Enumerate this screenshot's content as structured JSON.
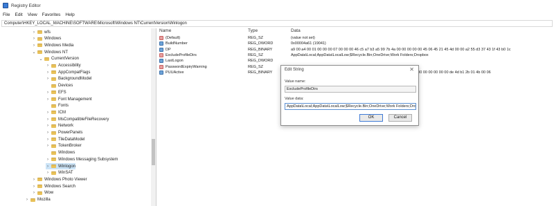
{
  "window": {
    "title": "Registry Editor"
  },
  "menu": [
    "File",
    "Edit",
    "View",
    "Favorites",
    "Help"
  ],
  "address": "Computer\\HKEY_LOCAL_MACHINE\\SOFTWARE\\Microsoft\\Windows NT\\CurrentVersion\\Winlogon",
  "tree": [
    {
      "label": "wfs",
      "chev": "›",
      "indent": 1
    },
    {
      "label": "Windows",
      "chev": "›",
      "indent": 1
    },
    {
      "label": "Windows Media",
      "chev": "›",
      "indent": 1
    },
    {
      "label": "Windows NT",
      "chev": "⌄",
      "indent": 1
    },
    {
      "label": "CurrentVersion",
      "chev": "⌄",
      "indent": 2
    },
    {
      "label": "Accessibility",
      "chev": "›",
      "indent": 3
    },
    {
      "label": "AppCompatFlags",
      "chev": "›",
      "indent": 3
    },
    {
      "label": "BackgroundModel",
      "chev": "›",
      "indent": 3
    },
    {
      "label": "Devices",
      "chev": "",
      "indent": 3
    },
    {
      "label": "EFS",
      "chev": "›",
      "indent": 3
    },
    {
      "label": "Font Management",
      "chev": "›",
      "indent": 3
    },
    {
      "label": "Fonts",
      "chev": "",
      "indent": 3
    },
    {
      "label": "ICM",
      "chev": "›",
      "indent": 3
    },
    {
      "label": "MsCompatibleFileRecovery",
      "chev": "›",
      "indent": 3
    },
    {
      "label": "Network",
      "chev": "›",
      "indent": 3
    },
    {
      "label": "PowerPanels",
      "chev": "›",
      "indent": 3
    },
    {
      "label": "TileDataModel",
      "chev": "›",
      "indent": 3
    },
    {
      "label": "TokenBroker",
      "chev": "›",
      "indent": 3
    },
    {
      "label": "Windows",
      "chev": "",
      "indent": 3
    },
    {
      "label": "Windows Messaging Subsystem",
      "chev": "›",
      "indent": 3
    },
    {
      "label": "Winlogon",
      "chev": "›",
      "indent": 3,
      "selected": true
    },
    {
      "label": "WinSAT",
      "chev": "›",
      "indent": 3
    },
    {
      "label": "Windows Photo Viewer",
      "chev": "›",
      "indent": 1
    },
    {
      "label": "Windows Search",
      "chev": "›",
      "indent": 1
    },
    {
      "label": "Wow",
      "chev": "›",
      "indent": 1
    },
    {
      "label": "Mozilla",
      "chev": "›",
      "indent": 0
    }
  ],
  "columns": {
    "name": "Name",
    "type": "Type",
    "data": "Data"
  },
  "values": [
    {
      "name": "(Default)",
      "type": "REG_SZ",
      "data": "(value not set)",
      "icon": "ab"
    },
    {
      "name": "BuildNumber",
      "type": "REG_DWORD",
      "data": "0x00004a61 (19041)",
      "icon": "bin"
    },
    {
      "name": "DP",
      "type": "REG_BINARY",
      "data": "a9 00 a4 00 01 00 00 00 07 00 00 00 46 c5 a7 b3 a5 99 7b 4a 00 00 00 00 00 45 06 45 21 45 4d 00 00 a2 55 d3 37 43 1f 43 b0 1c",
      "icon": "bin"
    },
    {
      "name": "ExcludeProfileDirs",
      "type": "REG_SZ",
      "data": "AppData\\Local;AppData\\LocalLow;$Recycle.Bin;OneDrive;Work Folders;Dropbox",
      "icon": "ab"
    },
    {
      "name": "LastLogon",
      "type": "REG_DWORD",
      "data": "",
      "icon": "bin"
    },
    {
      "name": "PasswordExpiryWarning",
      "type": "REG_SZ",
      "data": "",
      "icon": "ab"
    },
    {
      "name": "PUUActive",
      "type": "REG_BINARY",
      "data": "00 00 00 00 00 00 00 00 00 00 00 00 00 0b 00 00 00 00 57 c9 00 00 00 00 00 00 00 00 00 00 de 4d b1 2b 01 4b 00 06",
      "icon": "bin"
    }
  ],
  "dialog": {
    "title": "Edit String",
    "close": "✕",
    "value_name_label": "Value name:",
    "value_name": "ExcludeProfileDirs",
    "value_data_label": "Value data:",
    "value_data": "AppData\\Local;AppData\\LocalLow;$Recycle.Bin;OneDrive;Work Folders;Dropbox",
    "ok": "OK",
    "cancel": "Cancel"
  }
}
